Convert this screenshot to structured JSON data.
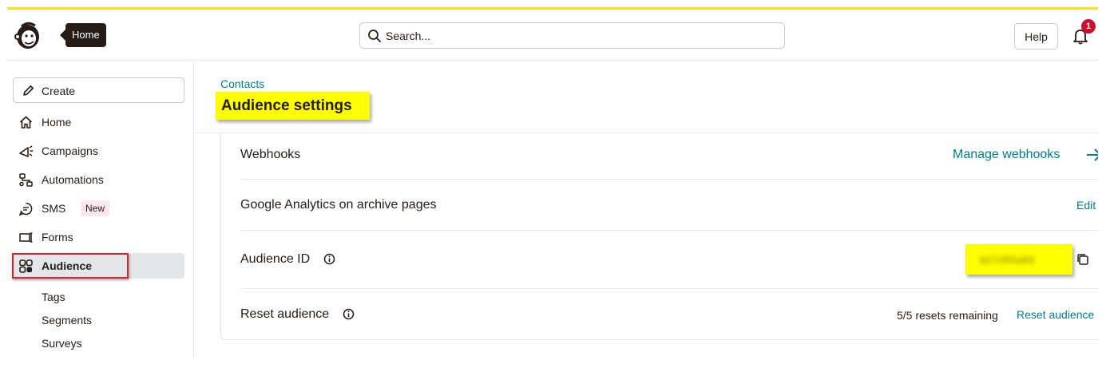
{
  "header": {
    "home_tooltip": "Home",
    "search_placeholder": "Search...",
    "help_label": "Help",
    "notification_count": "1"
  },
  "sidebar": {
    "create_label": "Create",
    "items": [
      {
        "label": "Home",
        "icon": "home-icon"
      },
      {
        "label": "Campaigns",
        "icon": "megaphone-icon"
      },
      {
        "label": "Automations",
        "icon": "flow-icon"
      },
      {
        "label": "SMS",
        "icon": "chat-icon",
        "badge": "New"
      },
      {
        "label": "Forms",
        "icon": "form-icon"
      },
      {
        "label": "Audience",
        "icon": "audience-icon",
        "active": true
      }
    ],
    "sub_items": [
      "Tags",
      "Segments",
      "Surveys"
    ]
  },
  "main": {
    "breadcrumb": "Contacts",
    "title": "Audience settings",
    "rows": {
      "webhooks": {
        "label": "Webhooks",
        "action": "Manage webhooks"
      },
      "analytics": {
        "label": "Google Analytics on archive pages",
        "action": "Edit"
      },
      "audience_id": {
        "label": "Audience ID",
        "value": "b07cf05a83"
      },
      "reset": {
        "label": "Reset audience",
        "status": "5/5 resets remaining",
        "action": "Reset audience"
      }
    }
  },
  "colors": {
    "accent": "#ffe01b",
    "link": "#007c89",
    "highlight": "#ffff00",
    "annotation_red": "#e0202f",
    "badge_red": "#c8102e"
  }
}
